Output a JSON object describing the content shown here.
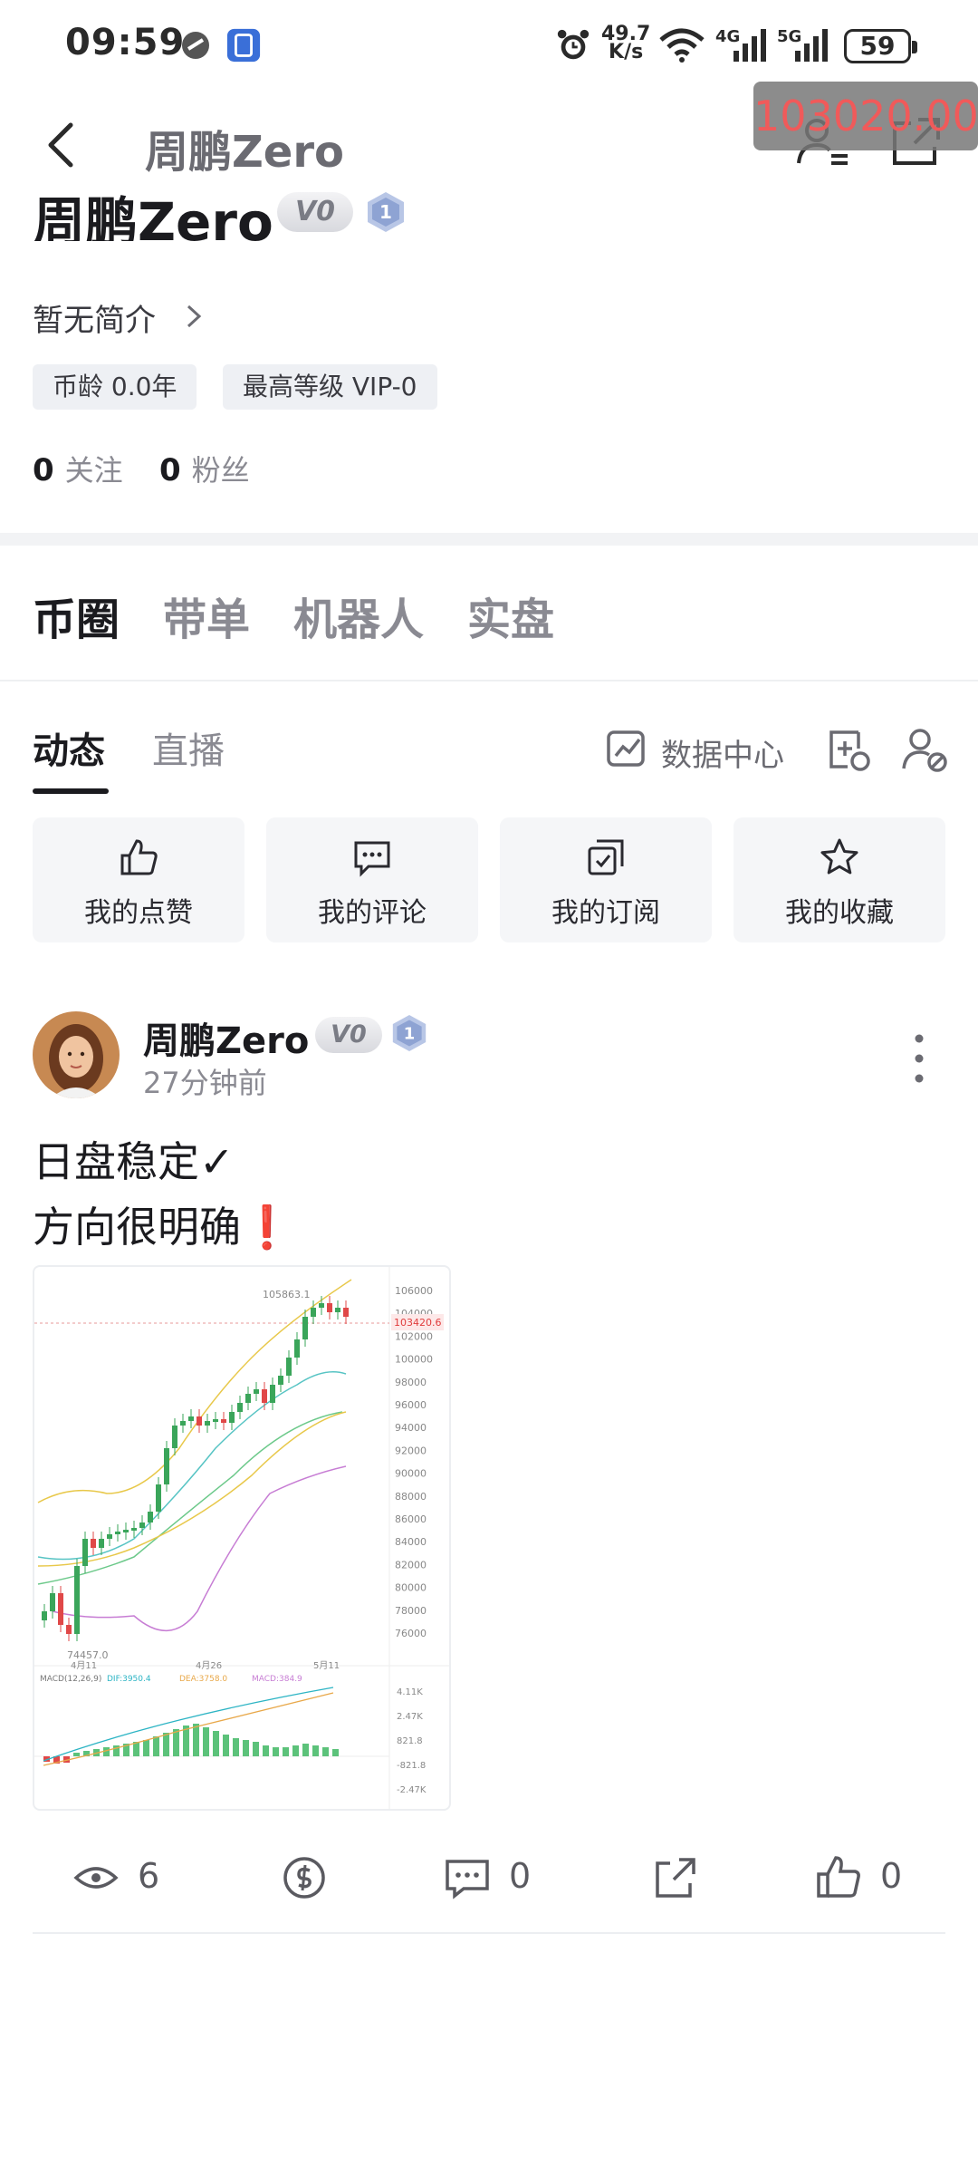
{
  "status_bar": {
    "time": "09:59",
    "speed_top": "49.7",
    "speed_bottom": "K/s",
    "net1": "4G",
    "net2": "5G",
    "battery": "59"
  },
  "header": {
    "title": "周鹏Zero",
    "price_overlay": "103020.00"
  },
  "profile": {
    "name": "周鹏Zero",
    "badge_vip": "V0",
    "badge_level": "1",
    "bio": "暂无简介",
    "tags": [
      "币龄 0.0年",
      "最高等级 VIP-0"
    ],
    "following_count": "0",
    "following_label": "关注",
    "followers_count": "0",
    "followers_label": "粉丝"
  },
  "main_tabs": [
    "币圈",
    "带单",
    "机器人",
    "实盘"
  ],
  "sub_tabs": [
    "动态",
    "直播"
  ],
  "data_center_label": "数据中心",
  "quick_actions": [
    "我的点赞",
    "我的评论",
    "我的订阅",
    "我的收藏"
  ],
  "post": {
    "author": "周鹏Zero",
    "badge_vip": "V0",
    "badge_level": "1",
    "time": "27分钟前",
    "line1": "日盘稳定✓",
    "line2": "方向很明确",
    "line2_emoji": "❗",
    "views": "6",
    "comments": "0",
    "likes": "0"
  },
  "chart": {
    "high_label": "105863.1",
    "low_label": "74457.0",
    "current_price": "103420.6",
    "y_ticks": [
      "106000",
      "104000",
      "102000",
      "100000",
      "98000",
      "96000",
      "94000",
      "92000",
      "90000",
      "88000",
      "86000",
      "84000",
      "82000",
      "80000",
      "78000",
      "76000"
    ],
    "x_ticks": [
      "4月11",
      "4月26",
      "5月11"
    ],
    "macd_header": "MACD(12,26,9)",
    "macd_dif": "DIF:3950.4",
    "macd_dea": "DEA:3758.0",
    "macd_val": "MACD:384.9",
    "macd_ticks": [
      "4.11K",
      "2.47K",
      "821.8",
      "-821.8",
      "-2.47K"
    ]
  }
}
